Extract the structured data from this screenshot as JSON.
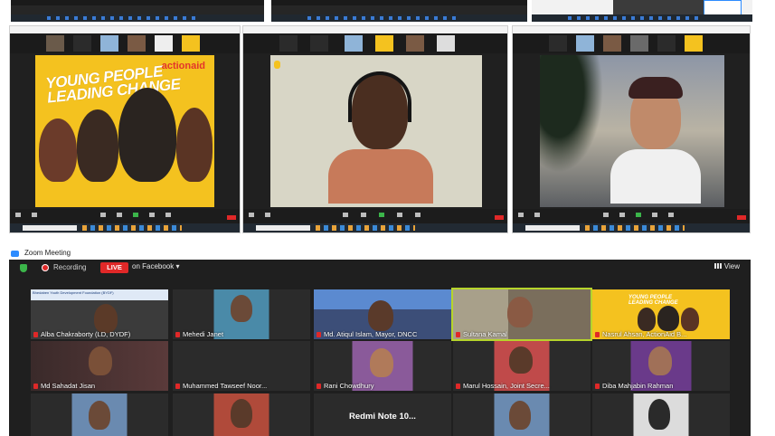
{
  "zoom_window": {
    "title": "Zoom Meeting",
    "recording_label": "Recording",
    "live_badge": "LIVE",
    "live_target": "on Facebook",
    "view_label": "View"
  },
  "poster": {
    "headline_line1": "YOUNG PEOPLE",
    "headline_line2": "LEADING CHANGE",
    "brand": "actionaid"
  },
  "participants": [
    {
      "name": "Alba Chakraborty (LD, DYDF)"
    },
    {
      "name": "Mehedi Janet"
    },
    {
      "name": "Md. Atiqul Islam, Mayor, DNCC"
    },
    {
      "name": "Sultana Kamal"
    },
    {
      "name": "Nasrul Ahsan, ActionAid B..."
    },
    {
      "name": "Md Sahadat Jisan"
    },
    {
      "name": "Muhammed Tawseef Noor..."
    },
    {
      "name": "Rani Chowdhury"
    },
    {
      "name": "Marul Hossain, Joint Secre..."
    },
    {
      "name": "Diba Mahjabin Rahman"
    },
    {
      "name": ""
    },
    {
      "name": ""
    },
    {
      "name": "",
      "center_text": "Redmi Note 10..."
    },
    {
      "name": ""
    },
    {
      "name": ""
    }
  ],
  "tile_banner": "Bhedaben Youth Development Foundation (BYDF)",
  "colors": {
    "zoom_bg": "#1f1f1f",
    "live_red": "#e02828",
    "active_speaker": "#b6d42b",
    "poster_yellow": "#f4c21f",
    "actionaid_red": "#e3352b"
  }
}
